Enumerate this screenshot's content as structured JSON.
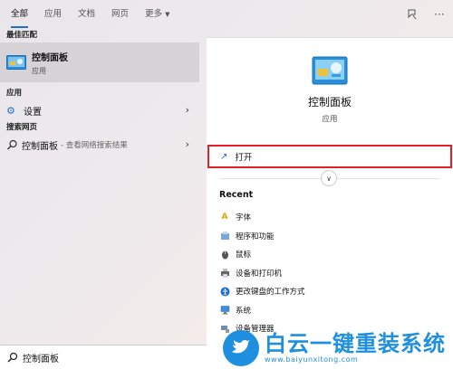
{
  "tabs": [
    {
      "label": "全部",
      "active": true
    },
    {
      "label": "应用"
    },
    {
      "label": "文档"
    },
    {
      "label": "网页"
    },
    {
      "label": "更多"
    }
  ],
  "left": {
    "best_match_label": "最佳匹配",
    "best_match": {
      "title": "控制面板",
      "type": "应用"
    },
    "apps_label": "应用",
    "settings": {
      "label": "设置"
    },
    "web_label": "搜索网页",
    "web_result": {
      "label": "控制面板",
      "sub": "- 查看网络搜索结果"
    }
  },
  "preview": {
    "title": "控制面板",
    "type": "应用",
    "open_label": "打开",
    "recent_title": "Recent",
    "recent": [
      {
        "label": "字体",
        "icon": "font-icon"
      },
      {
        "label": "程序和功能",
        "icon": "programs-icon"
      },
      {
        "label": "鼠标",
        "icon": "mouse-icon"
      },
      {
        "label": "设备和打印机",
        "icon": "printer-icon"
      },
      {
        "label": "更改键盘的工作方式",
        "icon": "accessibility-icon"
      },
      {
        "label": "系统",
        "icon": "system-icon"
      },
      {
        "label": "设备管理器",
        "icon": "device-manager-icon"
      }
    ]
  },
  "search": {
    "value": "控制面板"
  },
  "watermark": {
    "cn": "白云一键重装系统",
    "url": "www.baiyunxitong.com"
  },
  "colors": {
    "accent": "#1f6fd1",
    "highlight_border": "#e01f26",
    "watermark": "#1f8fe0"
  }
}
